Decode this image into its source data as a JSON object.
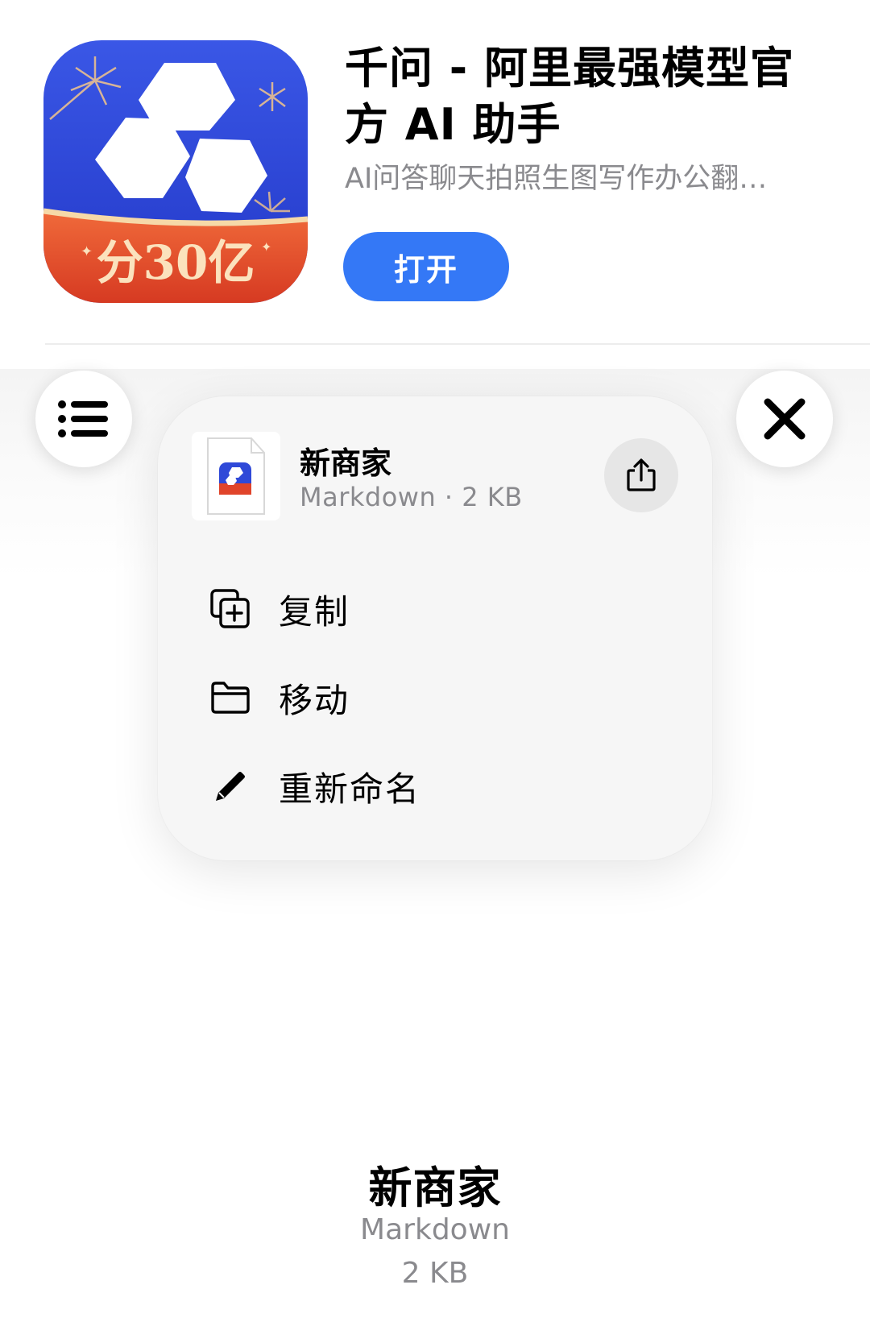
{
  "app_banner": {
    "title": "千问 - 阿里最强模型官方 AI 助手",
    "subtitle": "AI问答聊天拍照生图写作办公翻…",
    "open_label": "打开",
    "icon_badge_text": "分30亿",
    "colors": {
      "icon_blue": "#2f49d8",
      "icon_red": "#e0442a",
      "button_blue": "#3478f6"
    }
  },
  "toolbar": {
    "list_icon": "list-icon",
    "close_icon": "close-icon"
  },
  "menu": {
    "file_name": "新商家",
    "file_meta": "Markdown · 2 KB",
    "share_icon": "share-icon",
    "items": [
      {
        "label": "复制",
        "icon": "duplicate-icon"
      },
      {
        "label": "移动",
        "icon": "folder-icon"
      },
      {
        "label": "重新命名",
        "icon": "pencil-icon"
      }
    ]
  },
  "file_info": {
    "name": "新商家",
    "type": "Markdown",
    "size": "2 KB"
  }
}
